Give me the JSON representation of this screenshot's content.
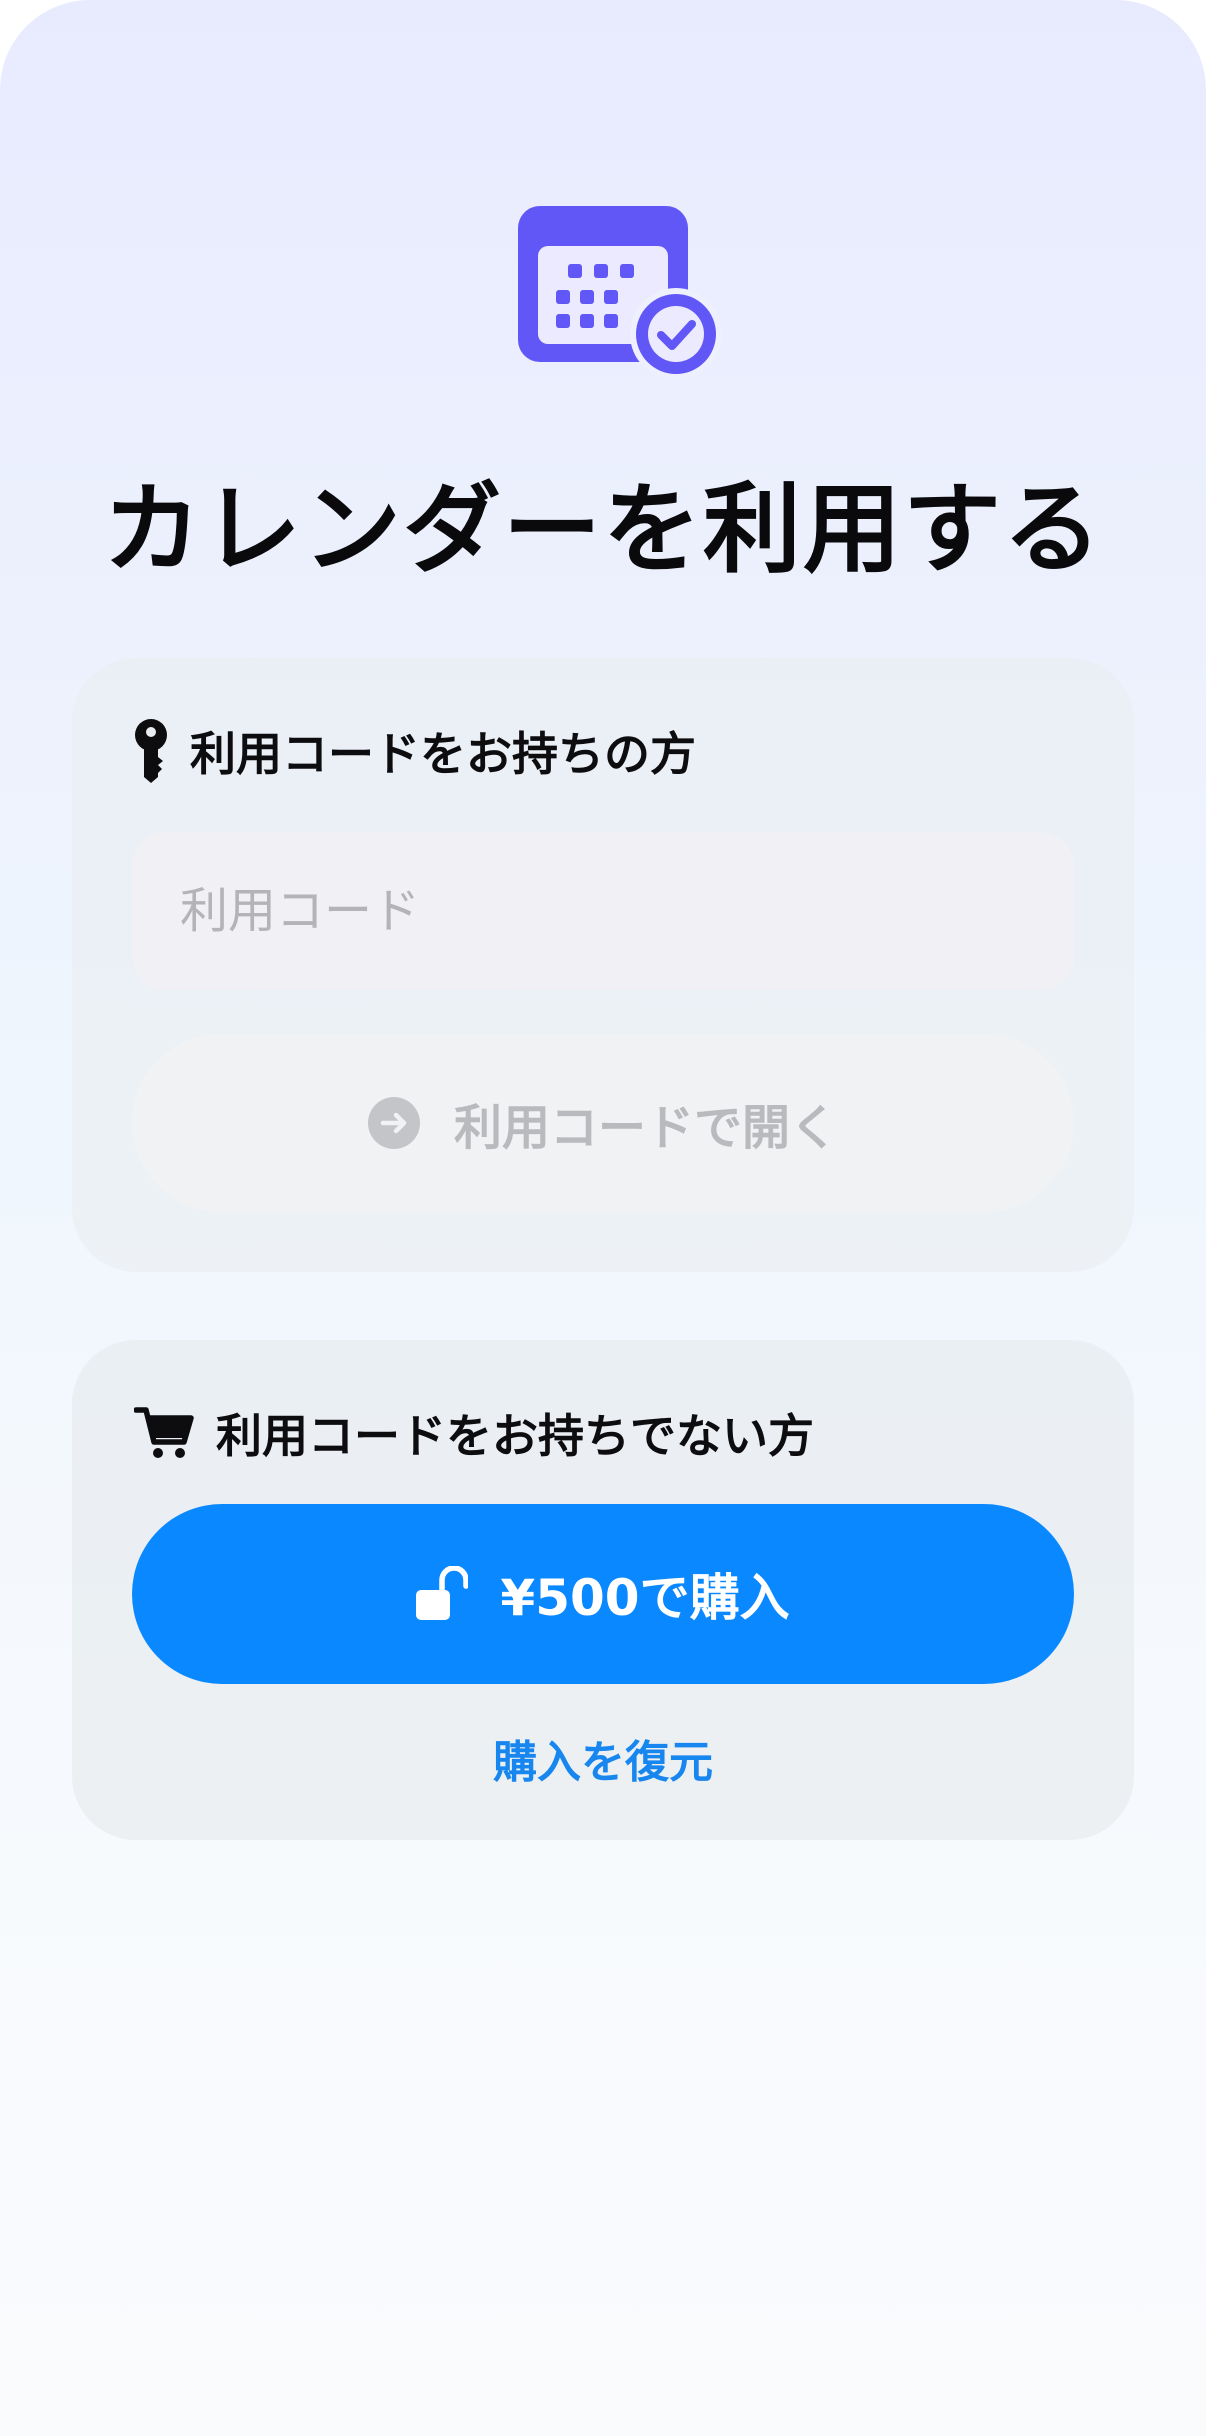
{
  "title": "カレンダーを利用する",
  "has_code_section": {
    "heading": "利用コードをお持ちの方",
    "icon": "key-icon",
    "input": {
      "value": "",
      "placeholder": "利用コード"
    },
    "open_button": {
      "label": "利用コードで開く",
      "icon": "arrow-right-circle-icon",
      "enabled": false
    }
  },
  "no_code_section": {
    "heading": "利用コードをお持ちでない方",
    "icon": "cart-icon",
    "buy_button": {
      "label": "¥500で購入",
      "icon": "unlock-icon"
    },
    "restore_link": "購入を復元"
  },
  "colors": {
    "accent": "#0A88FF",
    "icon_purple": "#6157F6",
    "disabled_text": "#B9BABE"
  }
}
